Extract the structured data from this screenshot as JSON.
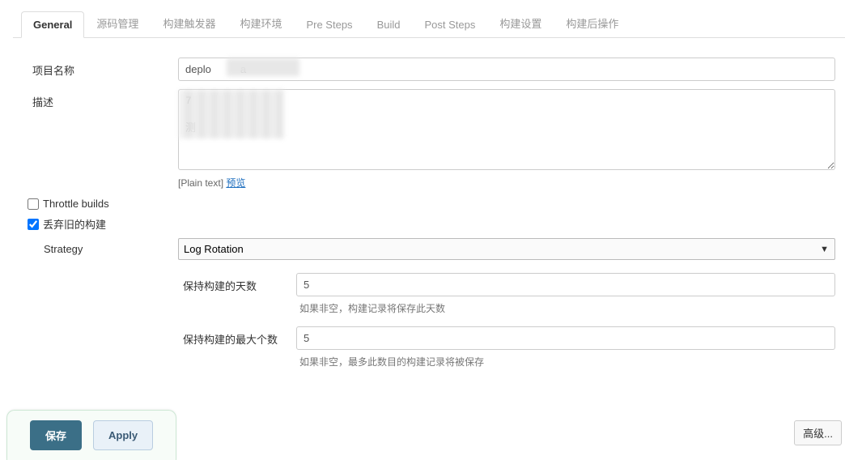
{
  "tabs": [
    {
      "label": "General",
      "active": true
    },
    {
      "label": "源码管理"
    },
    {
      "label": "构建触发器"
    },
    {
      "label": "构建环境"
    },
    {
      "label": "Pre Steps"
    },
    {
      "label": "Build"
    },
    {
      "label": "Post Steps"
    },
    {
      "label": "构建设置"
    },
    {
      "label": "构建后操作"
    }
  ],
  "form": {
    "projectName": {
      "label": "项目名称",
      "value": "deplo          a"
    },
    "description": {
      "label": "描述",
      "value": "7\n\n测",
      "plainLabel": "[Plain text]",
      "previewLabel": "预览"
    },
    "throttle": {
      "label": "Throttle builds",
      "checked": false
    },
    "discard": {
      "label": "丢弃旧的构建",
      "checked": true
    },
    "strategy": {
      "label": "Strategy",
      "value": "Log Rotation"
    },
    "keepDays": {
      "label": "保持构建的天数",
      "value": "5",
      "hint": "如果非空，构建记录将保存此天数"
    },
    "keepMax": {
      "label": "保持构建的最大个数",
      "value": "5",
      "hint": "如果非空，最多此数目的构建记录将被保存"
    },
    "advanced": "高级..."
  },
  "buttons": {
    "save": "保存",
    "apply": "Apply"
  }
}
